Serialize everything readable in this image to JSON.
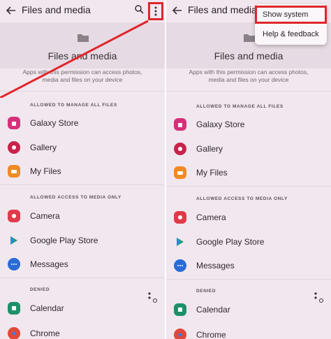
{
  "colors": {
    "highlight": "#e0262c",
    "background": "#f1e7ef"
  },
  "left": {
    "title": "Files and media",
    "header_title": "Files and media",
    "description": "Apps with this permission can access photos, media and files on your device",
    "sections": [
      "ALLOWED TO MANAGE ALL FILES",
      "ALLOWED ACCESS TO MEDIA ONLY",
      "DENIED"
    ],
    "items": [
      "Galaxy Store",
      "Gallery",
      "My Files",
      "Camera",
      "Google Play Store",
      "Messages",
      "Calendar",
      "Chrome"
    ]
  },
  "right": {
    "title": "Files and media",
    "header_title": "Files and media",
    "description": "Apps with this permission can access photos, media and files on your device",
    "sections": [
      "ALLOWED TO MANAGE ALL FILES",
      "ALLOWED ACCESS TO MEDIA ONLY",
      "DENIED"
    ],
    "items": [
      "Galaxy Store",
      "Gallery",
      "My Files",
      "Camera",
      "Google Play Store",
      "Messages",
      "Calendar",
      "Chrome"
    ],
    "menu": {
      "show_system": "Show system",
      "help_feedback": "Help & feedback"
    }
  }
}
